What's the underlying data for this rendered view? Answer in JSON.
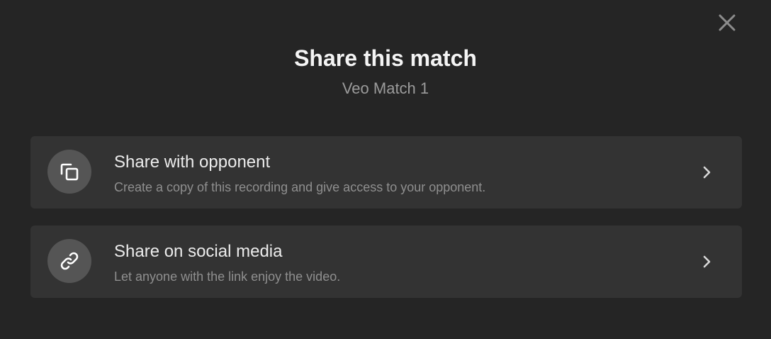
{
  "dialog": {
    "title": "Share this match",
    "subtitle": "Veo Match 1",
    "close_icon": "close-icon"
  },
  "options": [
    {
      "title": "Share with opponent",
      "description": "Create a copy of this recording and give access to your opponent.",
      "icon": "copy-icon"
    },
    {
      "title": "Share on social media",
      "description": "Let anyone with the link enjoy the video.",
      "icon": "link-icon"
    }
  ],
  "colors": {
    "background": "#252525",
    "card": "#333333",
    "icon_circle": "#555555",
    "title": "#f4f4f4",
    "subtitle": "#9b9b9b",
    "secondary_text": "#8f8f8f"
  }
}
